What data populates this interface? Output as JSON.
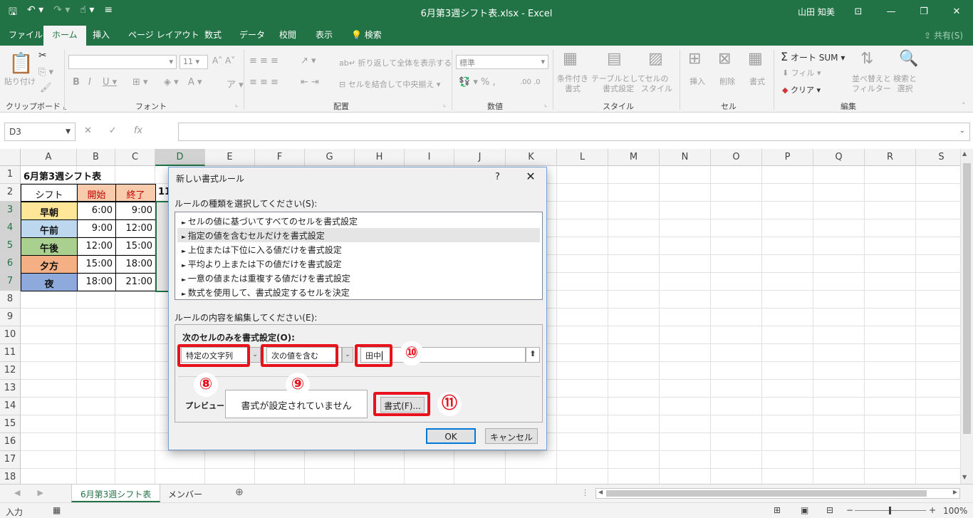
{
  "window": {
    "title": "6月第3週シフト表.xlsx  -  Excel",
    "user": "山田 知美"
  },
  "tabs": [
    "ファイル",
    "ホーム",
    "挿入",
    "ページ レイアウト",
    "数式",
    "データ",
    "校閲",
    "表示",
    "検索"
  ],
  "share_label": "共有(S)",
  "ribbon": {
    "clipboard": {
      "paste": "貼り付け",
      "label": "クリップボード"
    },
    "font": {
      "size": "11",
      "label": "フォント"
    },
    "alignment": {
      "wrap": "折り返して全体を表示する",
      "merge": "セルを結合して中央揃え",
      "label": "配置"
    },
    "number": {
      "format": "標準",
      "label": "数値"
    },
    "styles": {
      "conditional": "条件付き\n書式",
      "table": "テーブルとして\n書式設定",
      "cell": "セルの\nスタイル",
      "label": "スタイル"
    },
    "cells": {
      "insert": "挿入",
      "delete": "削除",
      "format": "書式",
      "label": "セル"
    },
    "editing": {
      "autosum": "オート SUM",
      "fill": "フィル",
      "clear": "クリア",
      "sort": "並べ替えと\nフィルター",
      "find": "検索と\n選択",
      "label": "編集"
    }
  },
  "namebox": "D3",
  "columns": [
    "A",
    "B",
    "C",
    "D",
    "E",
    "F",
    "G",
    "H",
    "I",
    "J",
    "K",
    "L",
    "M",
    "N",
    "O",
    "P",
    "Q",
    "R",
    "S"
  ],
  "rows": [
    "1",
    "2",
    "3",
    "4",
    "5",
    "6",
    "7",
    "8",
    "9",
    "10",
    "11",
    "12",
    "13",
    "14",
    "15",
    "16",
    "17",
    "18"
  ],
  "sheet": {
    "title": "6月第3週シフト表",
    "headers": [
      "シフト",
      "開始",
      "終了"
    ],
    "d2_partial": "11",
    "shifts": [
      {
        "name": "早朝",
        "start": "6:00",
        "end": "9:00",
        "color": "#ffe699"
      },
      {
        "name": "午前",
        "start": "9:00",
        "end": "12:00",
        "color": "#bdd7ee"
      },
      {
        "name": "午後",
        "start": "12:00",
        "end": "15:00",
        "color": "#a9d08e"
      },
      {
        "name": "夕方",
        "start": "15:00",
        "end": "18:00",
        "color": "#f4b084"
      },
      {
        "name": "夜",
        "start": "18:00",
        "end": "21:00",
        "color": "#8ea9db"
      }
    ]
  },
  "sheet_tabs": [
    "6月第3週シフト表",
    "メンバー"
  ],
  "status": {
    "mode": "入力",
    "zoom": "100%"
  },
  "dialog": {
    "title": "新しい書式ルール",
    "help": "?",
    "section1": "ルールの種類を選択してください(S):",
    "rules": [
      "セルの値に基づいてすべてのセルを書式設定",
      "指定の値を含むセルだけを書式設定",
      "上位または下位に入る値だけを書式設定",
      "平均より上または下の値だけを書式設定",
      "一意の値または重複する値だけを書式設定",
      "数式を使用して、書式設定するセルを決定"
    ],
    "section2": "ルールの内容を編集してください(E):",
    "subheading": "次のセルのみを書式設定(O):",
    "dropdown1": "特定の文字列",
    "dropdown2": "次の値を含む",
    "value_input": "田中",
    "preview_label": "プレビュー:",
    "preview_text": "書式が設定されていません",
    "format_button": "書式(F)...",
    "ok": "OK",
    "cancel": "キャンセル"
  },
  "callouts": [
    "⑧",
    "⑨",
    "⑩",
    "⑪"
  ],
  "colors": {
    "excel_green": "#217346",
    "highlight_red": "#e8121c"
  }
}
